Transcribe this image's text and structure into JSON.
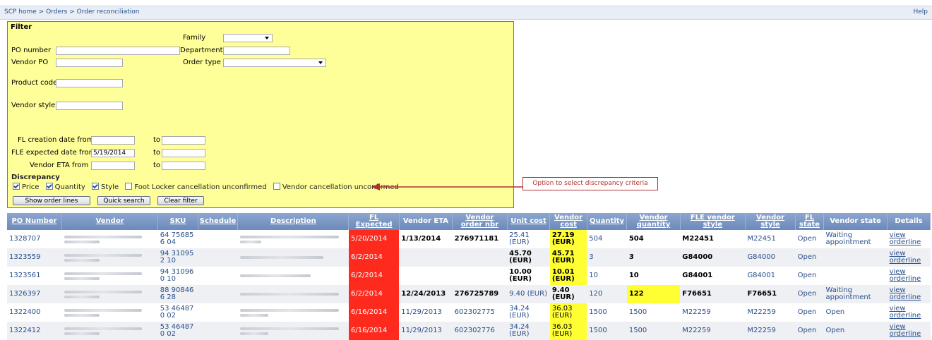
{
  "breadcrumb": {
    "home": "SCP home",
    "sep": " > ",
    "orders": "Orders",
    "current": "Order reconciliation",
    "help": "Help"
  },
  "filter": {
    "title": "Filter",
    "family_label": "Family",
    "po_number_label": "PO number",
    "department_label": "Department",
    "vendor_po_label": "Vendor PO",
    "order_type_label": "Order type",
    "product_code_label": "Product code",
    "vendor_style_label": "Vendor style",
    "fl_creation_from_label": "FL creation date from",
    "fle_expected_from_label": "FLE expected date from",
    "fle_expected_from_value": "5/19/2014",
    "vendor_eta_from_label": "Vendor ETA from",
    "to_label": "to",
    "discrepancy_title": "Discrepancy",
    "checkboxes": [
      {
        "label": "Price",
        "checked": true
      },
      {
        "label": "Quantity",
        "checked": true
      },
      {
        "label": "Style",
        "checked": true
      },
      {
        "label": "Foot Locker cancellation unconfirmed",
        "checked": false
      },
      {
        "label": "Vendor cancellation unconfirmed",
        "checked": false
      }
    ],
    "buttons": {
      "show_order_lines": "Show order lines",
      "quick_search": "Quick search",
      "clear_filter": "Clear filter"
    }
  },
  "callout": "Option to select discrepancy criteria",
  "colors": {
    "expected_late": "#ff2a1e",
    "discrepancy_highlight": "#ffff33",
    "header_blue": "#6b89ba",
    "link_blue": "#2a4f8a"
  },
  "table": {
    "headers": [
      "PO Number",
      "Vendor",
      "SKU",
      "Schedule",
      "Description",
      "FL Expected",
      "Vendor ETA",
      "Vendor order nbr",
      "Unit cost",
      "Vendor cost",
      "Quantity",
      "Vendor quantity",
      "FLE vendor style",
      "Vendor style",
      "FL state",
      "Vendor state",
      "Details"
    ],
    "rows": [
      {
        "po": "1328707",
        "sku": "64 75685 6 04",
        "fl_expected": "5/20/2014",
        "vendor_eta": "1/13/2014",
        "vendor_order": "276971181",
        "unit_cost": "25.41 (EUR)",
        "vendor_cost": "27.19 (EUR)",
        "quantity": "504",
        "vendor_qty": "504",
        "fle_vendor_style": "M22451",
        "vendor_style": "M22451",
        "fl_state": "Open",
        "vendor_state": "Waiting appointment",
        "details": "view orderline"
      },
      {
        "po": "1323559",
        "sku": "94 31095 2 10",
        "fl_expected": "6/2/2014",
        "vendor_eta": "",
        "vendor_order": "",
        "unit_cost": "45.70 (EUR)",
        "vendor_cost": "45.71 (EUR)",
        "quantity": "3",
        "vendor_qty": "3",
        "fle_vendor_style": "G84000",
        "vendor_style": "G84000",
        "fl_state": "Open",
        "vendor_state": "",
        "details": "view orderline"
      },
      {
        "po": "1323561",
        "sku": "94 31096 0 10",
        "fl_expected": "6/2/2014",
        "vendor_eta": "",
        "vendor_order": "",
        "unit_cost": "10.00 (EUR)",
        "vendor_cost": "10.01 (EUR)",
        "quantity": "10",
        "vendor_qty": "10",
        "fle_vendor_style": "G84001",
        "vendor_style": "G84001",
        "fl_state": "Open",
        "vendor_state": "",
        "details": "view orderline"
      },
      {
        "po": "1326397",
        "sku": "88 90846 6 28",
        "fl_expected": "6/2/2014",
        "vendor_eta": "12/24/2013",
        "vendor_order": "276725789",
        "unit_cost": "9.40 (EUR)",
        "vendor_cost": "9.40 (EUR)",
        "quantity": "120",
        "vendor_qty": "122",
        "fle_vendor_style": "F76651",
        "vendor_style": "F76651",
        "fl_state": "Open",
        "vendor_state": "Waiting appointment",
        "details": "view orderline"
      },
      {
        "po": "1322400",
        "sku": "53 46487 0 02",
        "fl_expected": "6/16/2014",
        "vendor_eta": "11/29/2013",
        "vendor_order": "602302775",
        "unit_cost": "34.24 (EUR)",
        "vendor_cost": "36.03 (EUR)",
        "quantity": "1500",
        "vendor_qty": "1500",
        "fle_vendor_style": "M22259",
        "vendor_style": "M22259",
        "fl_state": "Open",
        "vendor_state": "Open",
        "details": "view orderline"
      },
      {
        "po": "1322412",
        "sku": "53 46487 0 02",
        "fl_expected": "6/16/2014",
        "vendor_eta": "11/29/2013",
        "vendor_order": "602302776",
        "unit_cost": "34.24 (EUR)",
        "vendor_cost": "36.03 (EUR)",
        "quantity": "1500",
        "vendor_qty": "1500",
        "fle_vendor_style": "M22259",
        "vendor_style": "M22259",
        "fl_state": "Open",
        "vendor_state": "Open",
        "details": "view orderline"
      }
    ]
  }
}
